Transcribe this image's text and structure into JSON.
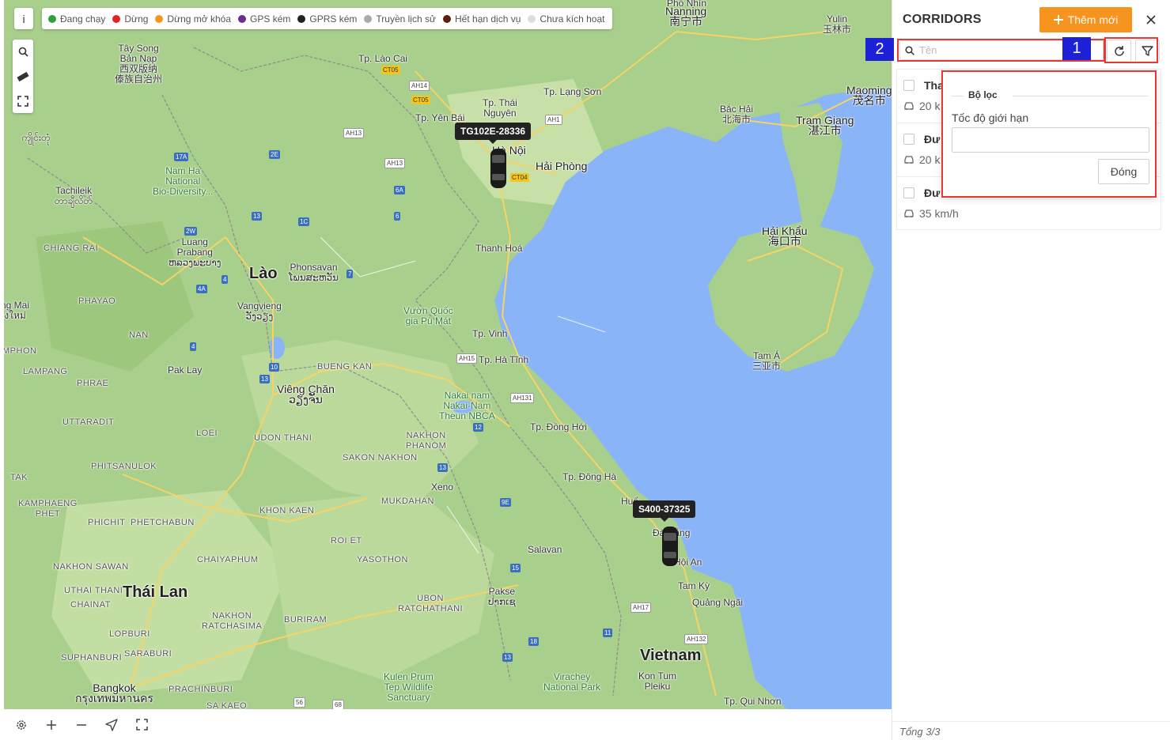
{
  "legend": [
    {
      "label": "Đang chạy",
      "color": "#2e9e3f"
    },
    {
      "label": "Dừng",
      "color": "#e02424"
    },
    {
      "label": "Dừng mở khóa",
      "color": "#f7941d"
    },
    {
      "label": "GPS kém",
      "color": "#6a2c91"
    },
    {
      "label": "GPRS kém",
      "color": "#222222"
    },
    {
      "label": "Truyền lịch sử",
      "color": "#aaaaaa"
    },
    {
      "label": "Hết hạn dịch vụ",
      "color": "#5b1f0e"
    },
    {
      "label": "Chưa kích hoạt",
      "color": "#dddddd"
    }
  ],
  "map": {
    "info_label": "i",
    "places": {
      "phonhin": "Phố Nhìn",
      "nanning": "Nanning\n南宁市",
      "yulin": "Yulin\n玉林市",
      "maoming": "Maoming\n茂名市",
      "taysong": "Tây Song\nBản Nạp\n西双版纳\n傣族自治州",
      "laocai": "Tp. Lào Cai",
      "thainguyen": "Tp. Thái\nNguyên",
      "langson": "Tp. Lạng Sơn",
      "yenbai": "Tp. Yên Bái",
      "bachai": "Bắc Hải\n北海市",
      "tramgiang": "Trạm Giang\n湛江市",
      "hanoi": "Hà Nội",
      "haiphong": "Hải Phòng",
      "mmyanmar": "ကျိုင်းတုံ",
      "namha": "Nam Ha\nNational\nBio-Diversity...",
      "tachileik": "Tachileik\nတာချီလိတ်",
      "chiangrai": "CHIANG RAI",
      "luangprabang": "Luang\nPrabang\nຫລວງພະບາງ",
      "laos": "Lào",
      "phonsavan": "Phonsavan\nໂພນສະຫວັນ",
      "thanhhoa": "Thanh Hoá",
      "haikhau": "Hải Khẩu\n海口市",
      "phayao": "PHAYAO",
      "ngmai": "ng Mai\nงใหม่",
      "vangvieng": "Vangvieng\nວັງວຽງ",
      "vuonquoc": "Vườn Quốc\ngia Pù Mát",
      "nan": "NAN",
      "tpvinh": "Tp. Vinh",
      "tama": "Tam Á\n三亚市",
      "mphon": "MPHON",
      "paklay": "Pak Lay",
      "bungkan": "BUENG KAN",
      "tphatinh": "Tp. Hà Tĩnh",
      "lampang": "LAMPANG",
      "phrae": "PHRAE",
      "vientiane": "Viêng Chăn\nວຽງຈັນ",
      "nakai": "Nakai nam\nNakai-Nam\nTheun NBCA",
      "uttaradit": "UTTARADIT",
      "loei": "LOEI",
      "udonthani": "UDON THANI",
      "nakhonphanom": "NAKHON\nPHANOM",
      "tpdonghoi": "Tp. Đồng Hới",
      "sakonnakhon": "SAKON NAKHON",
      "phitsanulok": "PHITSANULOK",
      "tak": "TAK",
      "xeno": "Xeno",
      "tpdongha": "Tp. Đông Hà",
      "kamphaeng": "KAMPHAENG\nPHET",
      "mukdahan": "MUKDAHAN",
      "hue": "Huế",
      "khonkaen": "KHON KAEN",
      "phichit": "PHICHIT",
      "phetchabun": "PHETCHABUN",
      "danang": "Đà Nẵng",
      "roiet": "ROI ET",
      "salavan": "Salavan",
      "hoian": "Hội An",
      "chaiyaphum": "CHAIYAPHUM",
      "yasothon": "YASOTHON",
      "nakhonsawan": "NAKHON SAWAN",
      "tamky": "Tam Kỳ",
      "thailand": "Thái Lan",
      "pakse": "Pakse\nປາກເຊ",
      "uthaithani": "UTHAI THANI",
      "chainat": "CHAINAT",
      "ubon": "UBON\nRATCHATHANI",
      "quangngai": "Quảng Ngãi",
      "nakhonratch": "NAKHON\nRATCHASIMA",
      "buriram": "BURIRAM",
      "lopburi": "LOPBURI",
      "vietnam": "Vietnam",
      "suphanburi": "SUPHANBURI",
      "saraburi": "SARABURI",
      "kulen": "Kulen Prum\nTep Wildlife\nSanctuary",
      "virachey": "Virachey\nNational Park",
      "kontum": "Kon Tum\nPleiku",
      "bangkok": "Bangkok\nกรุงเทพมหานคร",
      "prachinburi": "PRACHINBURI",
      "sakaeo": "SA KAEO",
      "quinhon": "Tp. Qui Nhơn"
    },
    "roads": {
      "ct05a": "CT05",
      "ah14": "AH14",
      "ct05b": "CT05",
      "ah1a": "AH1",
      "ah13a": "AH13",
      "ah13b": "AH13",
      "ct04": "CT04",
      "r17a": "17A",
      "r2e": "2E",
      "r6a": "6A",
      "r13a": "13",
      "r1c": "1C",
      "r6": "6",
      "r2w": "2W",
      "r4a": "4",
      "r7": "7",
      "r4b": "4A",
      "r4c": "4",
      "r10": "10",
      "r13b": "13",
      "ah15": "AH15",
      "ah131": "AH131",
      "r12": "12",
      "r13c": "13",
      "r9e": "9E",
      "r15": "15",
      "ah17": "AH17",
      "ah132": "AH132",
      "r18": "18",
      "r11": "11",
      "r13d": "13",
      "r56": "56",
      "r68": "68"
    },
    "vehicles": [
      {
        "plate": "TG102E-28336"
      },
      {
        "plate": "S400-37325"
      }
    ]
  },
  "panel": {
    "title": "CORRIDORS",
    "add_label": "Thêm mới",
    "search_placeholder": "Tên",
    "badge_1": "1",
    "badge_2": "2",
    "items": [
      {
        "name": "Tha",
        "speed": "20 k"
      },
      {
        "name": "Đư",
        "speed": "20 k"
      },
      {
        "name": "Đư",
        "speed": "35 km/h"
      }
    ],
    "filter": {
      "title": "Bộ lọc",
      "speed_label": "Tốc độ giới hạn",
      "speed_value": "",
      "close_label": "Đóng"
    },
    "footer": "Tổng 3/3"
  }
}
